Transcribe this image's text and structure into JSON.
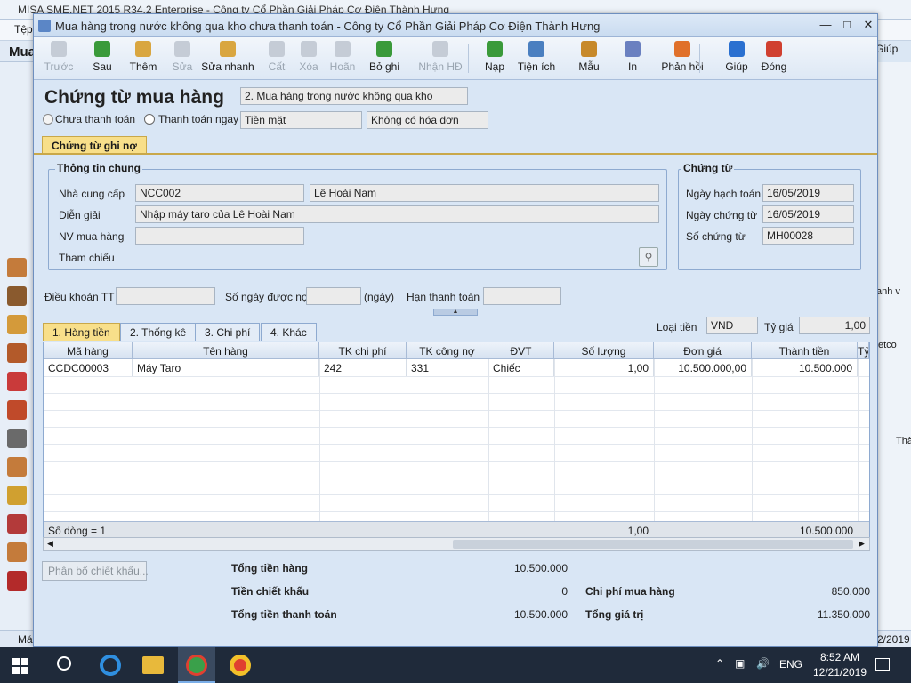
{
  "bg": {
    "app_title": "MISA SME.NET 2015 R34.2 Enterprise - Công ty Cổ Phần Giải Pháp Cơ Điện Thành Hưng",
    "menu_first": "Tệp",
    "side_title": "Mua",
    "help": "Giúp",
    "status_left": "Má",
    "date_right": "2/2019",
    "right_frag1": "anh v",
    "right_frag2": "etco",
    "right_frag3": "Thà"
  },
  "dialog": {
    "title": "Mua hàng trong nước không qua kho chưa thanh toán - Công ty Cổ Phần Giải Pháp Cơ Điện Thành Hưng",
    "toolbar": [
      {
        "label": "Trước",
        "icon": "arrow-left-icon",
        "enabled": false
      },
      {
        "label": "Sau",
        "icon": "arrow-right-icon",
        "enabled": true
      },
      {
        "label": "Thêm",
        "icon": "add-document-icon",
        "enabled": true
      },
      {
        "label": "Sửa",
        "icon": "edit-icon",
        "enabled": false
      },
      {
        "label": "Sửa nhanh",
        "icon": "quick-edit-icon",
        "enabled": true
      },
      {
        "label": "Cất",
        "icon": "save-icon",
        "enabled": false
      },
      {
        "label": "Xóa",
        "icon": "delete-icon",
        "enabled": false
      },
      {
        "label": "Hoãn",
        "icon": "undo-icon",
        "enabled": false
      },
      {
        "label": "Bỏ ghi",
        "icon": "unpost-icon",
        "enabled": true
      },
      {
        "label": "Nhận HĐ",
        "icon": "receive-invoice-icon",
        "enabled": false
      },
      {
        "label": "Nạp",
        "icon": "refresh-icon",
        "enabled": true
      },
      {
        "label": "Tiện ích",
        "icon": "tools-icon",
        "enabled": true
      },
      {
        "label": "Mẫu",
        "icon": "template-icon",
        "enabled": true
      },
      {
        "label": "In",
        "icon": "print-icon",
        "enabled": true
      },
      {
        "label": "Phản hồi",
        "icon": "mail-icon",
        "enabled": true
      },
      {
        "label": "Giúp",
        "icon": "help-icon",
        "enabled": true
      },
      {
        "label": "Đóng",
        "icon": "close-icon",
        "enabled": true
      }
    ],
    "doc_title": "Chứng từ mua hàng",
    "doc_type": "2. Mua hàng trong nước không qua kho",
    "radio_unpaid": "Chưa thanh toán",
    "radio_paid": "Thanh toán ngay",
    "payment_method": "Tiền mặt",
    "invoice_option": "Không có hóa đơn",
    "tab_voucher": "Chứng từ ghi nợ",
    "general_legend": "Thông tin chung",
    "supplier_label": "Nhà cung cấp",
    "supplier_code": "NCC002",
    "supplier_name": "Lê Hoài Nam",
    "desc_label": "Diễn giải",
    "desc_value": "Nhập máy taro của Lê Hoài Nam",
    "staff_label": "NV mua hàng",
    "staff_value": "",
    "ref_label": "Tham chiếu",
    "voucher_legend": "Chứng từ",
    "posting_date_label": "Ngày hạch toán",
    "posting_date": "16/05/2019",
    "voucher_date_label": "Ngày chứng từ",
    "voucher_date": "16/05/2019",
    "voucher_no_label": "Số chứng từ",
    "voucher_no": "MH00028",
    "terms_label": "Điều khoản TT",
    "terms_value": "",
    "days_label": "Số ngày được nợ",
    "days_value": "",
    "days_unit": "(ngày)",
    "due_label": "Hạn thanh toán",
    "due_value": "",
    "currency_label": "Loại tiền",
    "currency": "VND",
    "rate_label": "Tỷ giá",
    "rate": "1,00",
    "tabs": [
      {
        "label": "1. Hàng tiền"
      },
      {
        "label": "2. Thống kê"
      },
      {
        "label": "3. Chi phí"
      },
      {
        "label": "4. Khác"
      }
    ],
    "columns": [
      "Mã hàng",
      "Tên hàng",
      "TK chi phí",
      "TK công nợ",
      "ĐVT",
      "Số lượng",
      "Đơn giá",
      "Thành tiền",
      "Tỷ"
    ],
    "rows": [
      [
        "CCDC00003",
        "Máy Taro",
        "242",
        "331",
        "Chiếc",
        "1,00",
        "10.500.000,00",
        "10.500.000"
      ]
    ],
    "row_count": "Số dòng = 1",
    "sum_qty": "1,00",
    "sum_amount": "10.500.000",
    "discount_btn": "Phân bổ chiết khấu...",
    "total_goods_label": "Tổng tiền hàng",
    "total_goods": "10.500.000",
    "discount_label": "Tiền chiết khấu",
    "discount": "0",
    "total_pay_label": "Tổng tiền thanh toán",
    "total_pay": "10.500.000",
    "purchase_cost_label": "Chi phí mua hàng",
    "purchase_cost": "850.000",
    "total_value_label": "Tổng giá trị",
    "total_value": "11.350.000"
  },
  "taskbar": {
    "lang": "ENG",
    "time": "8:52 AM",
    "date": "12/21/2019"
  }
}
